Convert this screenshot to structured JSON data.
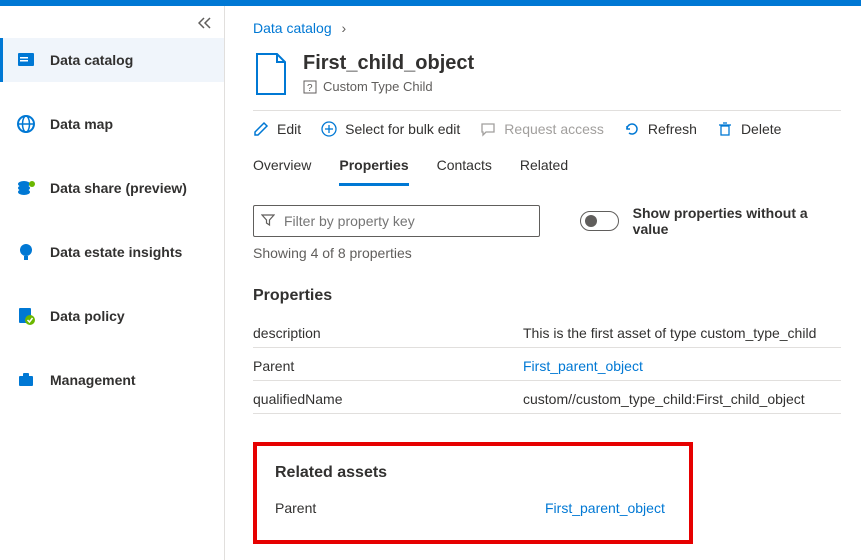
{
  "sidebar": {
    "items": [
      {
        "label": "Data catalog"
      },
      {
        "label": "Data map"
      },
      {
        "label": "Data share (preview)"
      },
      {
        "label": "Data estate insights"
      },
      {
        "label": "Data policy"
      },
      {
        "label": "Management"
      }
    ]
  },
  "breadcrumb": {
    "root": "Data catalog"
  },
  "asset": {
    "title": "First_child_object",
    "subtype": "Custom Type Child"
  },
  "toolbar": {
    "edit": "Edit",
    "bulk": "Select for bulk edit",
    "request": "Request access",
    "refresh": "Refresh",
    "delete": "Delete"
  },
  "tabs": {
    "overview": "Overview",
    "properties": "Properties",
    "contacts": "Contacts",
    "related": "Related"
  },
  "filter": {
    "placeholder": "Filter by property key",
    "toggle_label": "Show properties without a value",
    "showing": "Showing 4 of 8 properties"
  },
  "sections": {
    "properties": "Properties",
    "related_assets": "Related assets"
  },
  "properties": [
    {
      "key": "description",
      "value": "This is the first asset of type custom_type_child",
      "link": false
    },
    {
      "key": "Parent",
      "value": "First_parent_object",
      "link": true
    },
    {
      "key": "qualifiedName",
      "value": "custom//custom_type_child:First_child_object",
      "link": false
    }
  ],
  "related": [
    {
      "key": "Parent",
      "value": "First_parent_object",
      "link": true
    }
  ]
}
